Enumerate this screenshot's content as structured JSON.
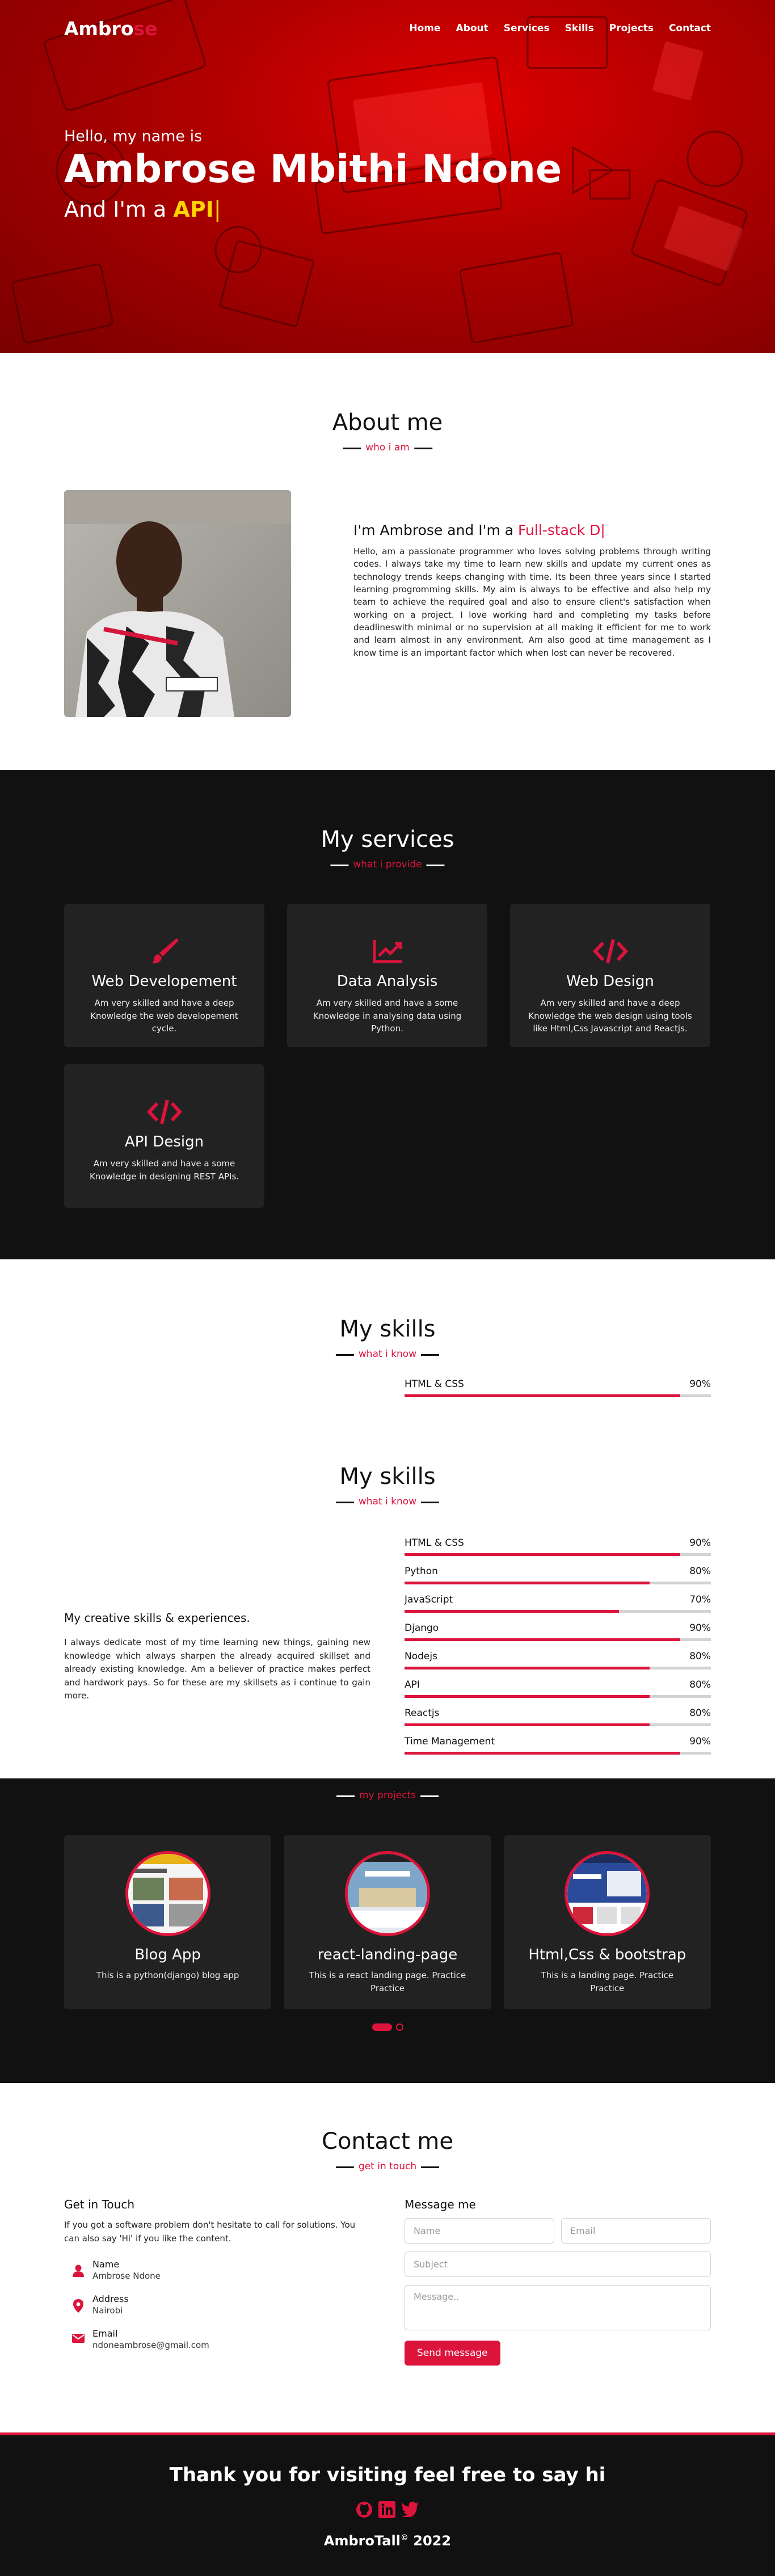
{
  "brand": {
    "logo_main": "Ambro",
    "logo_accent": "se",
    "accent_color": "#dc143c"
  },
  "nav": {
    "items": [
      "Home",
      "About",
      "Services",
      "Skills",
      "Projects",
      "Contact"
    ]
  },
  "home": {
    "greeting": "Hello, my name is",
    "name": "Ambrose Mbithi Ndone",
    "role_prefix": "And I'm a",
    "role_typed": "API"
  },
  "about": {
    "title": "About me",
    "subtitle": "who i am",
    "heading_prefix": "I'm Ambrose and I'm a",
    "heading_typed": "Full-stack D",
    "paragraph": "Hello, am a passionate programmer who loves solving problems through writing codes. I always take my time to learn new skills and update my current ones as technology trends keeps changing with time. Its been three years since I started learning progromming skills. My aim is always to be effective and also help my team to achieve the required goal and also to ensure client's satisfaction when working on a project. I love working hard and completing my tasks before deadlineswith minimal or no supervision at all making it efficient for me to work and learn almost in any environment. Am also good at time management as I know time is an important factor which when lost can never be recovered."
  },
  "services": {
    "title": "My services",
    "subtitle": "what i provide",
    "items": [
      {
        "icon": "paint-brush-icon",
        "name": "Web Developement",
        "desc": "Am very skilled and have a deep Knowledge the web developement cycle."
      },
      {
        "icon": "chart-line-icon",
        "name": "Data Analysis",
        "desc": "Am very skilled and have a some Knowledge in analysing data using Python."
      },
      {
        "icon": "code-icon",
        "name": "Web Design",
        "desc": "Am very skilled and have a deep Knowledge the web design using tools like Html,Css Javascript and Reactjs."
      },
      {
        "icon": "code-icon",
        "name": "API Design",
        "desc": "Am very skilled and have a some Knowledge in designing REST APIs."
      }
    ]
  },
  "skills": {
    "title": "My skills",
    "subtitle": "what i know",
    "peek_bar": {
      "name": "HTML & CSS",
      "label": "90%",
      "value": 90
    },
    "heading": "My creative skills & experiences.",
    "paragraph": "I always dedicate most of my time learning new things, gaining new knowledge which always sharpen the already acquired skillset and already existing knowledge. Am a believer of practice makes perfect and hardwork pays. So for these are my skillsets as i continue to gain more.",
    "bars": [
      {
        "name": "HTML & CSS",
        "label": "90%",
        "value": 90
      },
      {
        "name": "Python",
        "label": "80%",
        "value": 80
      },
      {
        "name": "JavaScript",
        "label": "70%",
        "value": 70
      },
      {
        "name": "Django",
        "label": "90%",
        "value": 90
      },
      {
        "name": "Nodejs",
        "label": "80%",
        "value": 80
      },
      {
        "name": "API",
        "label": "80%",
        "value": 80
      },
      {
        "name": "Reactjs",
        "label": "80%",
        "value": 80
      },
      {
        "name": "Time Management",
        "label": "90%",
        "value": 90
      }
    ]
  },
  "projects": {
    "subtitle": "my projects",
    "items": [
      {
        "name": "Blog App",
        "desc": "This is a python(django) blog app"
      },
      {
        "name": "react-landing-page",
        "desc": "This is a react landing page. Practice Practice"
      },
      {
        "name": "Html,Css & bootstrap",
        "desc": "This is a landing page. Practice Practice"
      }
    ]
  },
  "contact": {
    "title": "Contact me",
    "subtitle": "get in touch",
    "left_heading": "Get in Touch",
    "left_paragraph": "If you got a software problem don't hesitate to call for solutions. You can also say 'Hi' if you like the content.",
    "info": [
      {
        "icon": "user-icon",
        "label": "Name",
        "value": "Ambrose Ndone"
      },
      {
        "icon": "map-marker-icon",
        "label": "Address",
        "value": "Nairobi"
      },
      {
        "icon": "envelope-icon",
        "label": "Email",
        "value": "ndoneambrose@gmail.com"
      }
    ],
    "form_heading": "Message me",
    "name_placeholder": "Name",
    "email_placeholder": "Email",
    "subject_placeholder": "Subject",
    "message_placeholder": "Message..",
    "send_label": "Send message"
  },
  "footer": {
    "thanks": "Thank you for visiting feel free to say hi",
    "social": [
      "github-icon",
      "linkedin-icon",
      "twitter-icon"
    ],
    "copyright_text": "AmbroTall",
    "copyright_mark": "©",
    "copyright_year": " 2022"
  }
}
